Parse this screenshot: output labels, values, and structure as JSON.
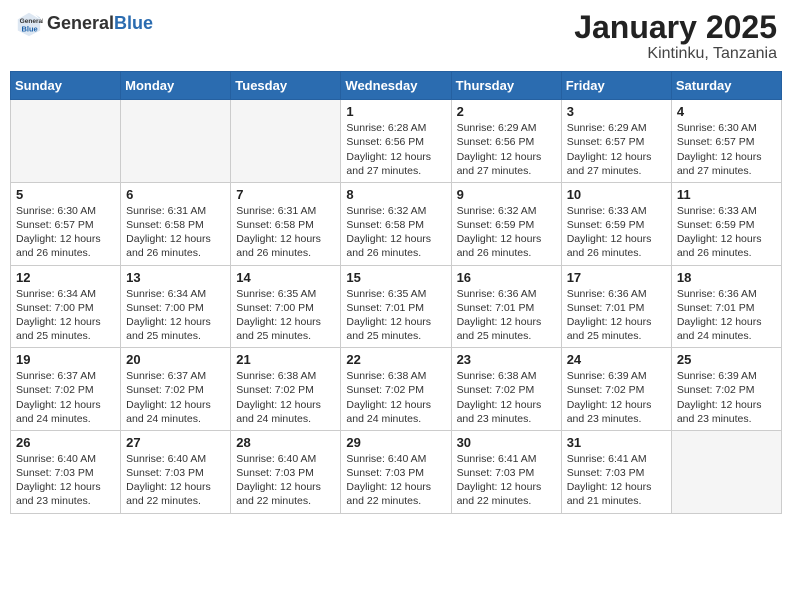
{
  "header": {
    "logo_general": "General",
    "logo_blue": "Blue",
    "month_year": "January 2025",
    "location": "Kintinku, Tanzania"
  },
  "days_of_week": [
    "Sunday",
    "Monday",
    "Tuesday",
    "Wednesday",
    "Thursday",
    "Friday",
    "Saturday"
  ],
  "weeks": [
    [
      {
        "day": "",
        "info": ""
      },
      {
        "day": "",
        "info": ""
      },
      {
        "day": "",
        "info": ""
      },
      {
        "day": "1",
        "info": "Sunrise: 6:28 AM\nSunset: 6:56 PM\nDaylight: 12 hours\nand 27 minutes."
      },
      {
        "day": "2",
        "info": "Sunrise: 6:29 AM\nSunset: 6:56 PM\nDaylight: 12 hours\nand 27 minutes."
      },
      {
        "day": "3",
        "info": "Sunrise: 6:29 AM\nSunset: 6:57 PM\nDaylight: 12 hours\nand 27 minutes."
      },
      {
        "day": "4",
        "info": "Sunrise: 6:30 AM\nSunset: 6:57 PM\nDaylight: 12 hours\nand 27 minutes."
      }
    ],
    [
      {
        "day": "5",
        "info": "Sunrise: 6:30 AM\nSunset: 6:57 PM\nDaylight: 12 hours\nand 26 minutes."
      },
      {
        "day": "6",
        "info": "Sunrise: 6:31 AM\nSunset: 6:58 PM\nDaylight: 12 hours\nand 26 minutes."
      },
      {
        "day": "7",
        "info": "Sunrise: 6:31 AM\nSunset: 6:58 PM\nDaylight: 12 hours\nand 26 minutes."
      },
      {
        "day": "8",
        "info": "Sunrise: 6:32 AM\nSunset: 6:58 PM\nDaylight: 12 hours\nand 26 minutes."
      },
      {
        "day": "9",
        "info": "Sunrise: 6:32 AM\nSunset: 6:59 PM\nDaylight: 12 hours\nand 26 minutes."
      },
      {
        "day": "10",
        "info": "Sunrise: 6:33 AM\nSunset: 6:59 PM\nDaylight: 12 hours\nand 26 minutes."
      },
      {
        "day": "11",
        "info": "Sunrise: 6:33 AM\nSunset: 6:59 PM\nDaylight: 12 hours\nand 26 minutes."
      }
    ],
    [
      {
        "day": "12",
        "info": "Sunrise: 6:34 AM\nSunset: 7:00 PM\nDaylight: 12 hours\nand 25 minutes."
      },
      {
        "day": "13",
        "info": "Sunrise: 6:34 AM\nSunset: 7:00 PM\nDaylight: 12 hours\nand 25 minutes."
      },
      {
        "day": "14",
        "info": "Sunrise: 6:35 AM\nSunset: 7:00 PM\nDaylight: 12 hours\nand 25 minutes."
      },
      {
        "day": "15",
        "info": "Sunrise: 6:35 AM\nSunset: 7:01 PM\nDaylight: 12 hours\nand 25 minutes."
      },
      {
        "day": "16",
        "info": "Sunrise: 6:36 AM\nSunset: 7:01 PM\nDaylight: 12 hours\nand 25 minutes."
      },
      {
        "day": "17",
        "info": "Sunrise: 6:36 AM\nSunset: 7:01 PM\nDaylight: 12 hours\nand 25 minutes."
      },
      {
        "day": "18",
        "info": "Sunrise: 6:36 AM\nSunset: 7:01 PM\nDaylight: 12 hours\nand 24 minutes."
      }
    ],
    [
      {
        "day": "19",
        "info": "Sunrise: 6:37 AM\nSunset: 7:02 PM\nDaylight: 12 hours\nand 24 minutes."
      },
      {
        "day": "20",
        "info": "Sunrise: 6:37 AM\nSunset: 7:02 PM\nDaylight: 12 hours\nand 24 minutes."
      },
      {
        "day": "21",
        "info": "Sunrise: 6:38 AM\nSunset: 7:02 PM\nDaylight: 12 hours\nand 24 minutes."
      },
      {
        "day": "22",
        "info": "Sunrise: 6:38 AM\nSunset: 7:02 PM\nDaylight: 12 hours\nand 24 minutes."
      },
      {
        "day": "23",
        "info": "Sunrise: 6:38 AM\nSunset: 7:02 PM\nDaylight: 12 hours\nand 23 minutes."
      },
      {
        "day": "24",
        "info": "Sunrise: 6:39 AM\nSunset: 7:02 PM\nDaylight: 12 hours\nand 23 minutes."
      },
      {
        "day": "25",
        "info": "Sunrise: 6:39 AM\nSunset: 7:02 PM\nDaylight: 12 hours\nand 23 minutes."
      }
    ],
    [
      {
        "day": "26",
        "info": "Sunrise: 6:40 AM\nSunset: 7:03 PM\nDaylight: 12 hours\nand 23 minutes."
      },
      {
        "day": "27",
        "info": "Sunrise: 6:40 AM\nSunset: 7:03 PM\nDaylight: 12 hours\nand 22 minutes."
      },
      {
        "day": "28",
        "info": "Sunrise: 6:40 AM\nSunset: 7:03 PM\nDaylight: 12 hours\nand 22 minutes."
      },
      {
        "day": "29",
        "info": "Sunrise: 6:40 AM\nSunset: 7:03 PM\nDaylight: 12 hours\nand 22 minutes."
      },
      {
        "day": "30",
        "info": "Sunrise: 6:41 AM\nSunset: 7:03 PM\nDaylight: 12 hours\nand 22 minutes."
      },
      {
        "day": "31",
        "info": "Sunrise: 6:41 AM\nSunset: 7:03 PM\nDaylight: 12 hours\nand 21 minutes."
      },
      {
        "day": "",
        "info": ""
      }
    ]
  ]
}
